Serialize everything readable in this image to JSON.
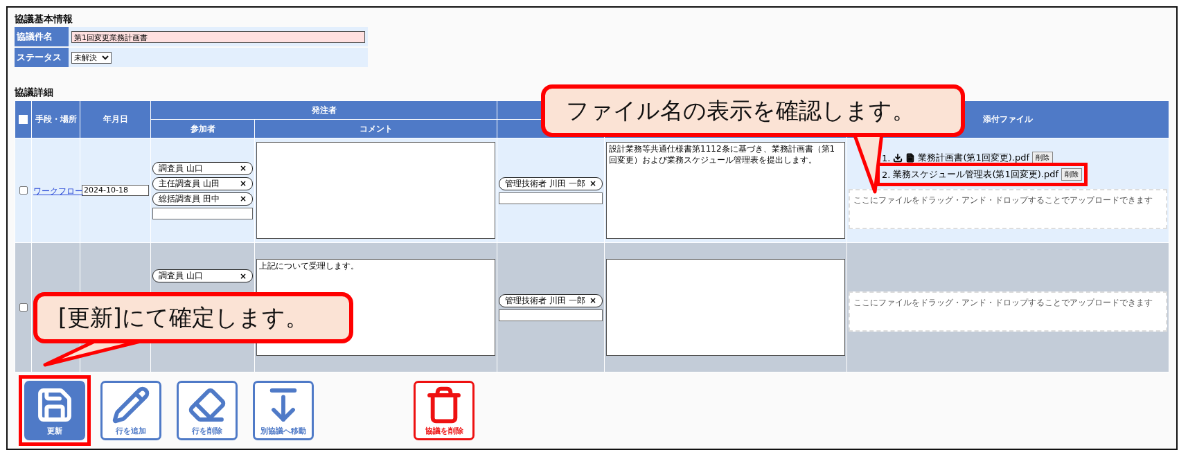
{
  "basic_info": {
    "title": "協議基本情報",
    "fields": [
      {
        "kind": "text",
        "label": "協議件名",
        "value": "第1回変更業務計画書"
      },
      {
        "kind": "select",
        "label": "ステータス",
        "value": "未解決"
      }
    ]
  },
  "details": {
    "title": "協議詳細",
    "header": {
      "select_all_checked": false,
      "columns": [
        "手段・場所",
        "年月日"
      ],
      "group": "発注者",
      "group_columns": [
        "参加者",
        "コメント"
      ],
      "attachments": "添付ファイル"
    },
    "rows": [
      {
        "checked": false,
        "method": "ワークフロー",
        "date": "2024-10-18",
        "orderer_participants": [
          {
            "name": "調査員 山口",
            "remove": "×"
          },
          {
            "name": "主任調査員 山田",
            "remove": "×"
          },
          {
            "name": "総括調査員 田中",
            "remove": "×"
          }
        ],
        "orderer_comment": "",
        "contractor_participants": [
          {
            "name": "管理技術者 川田 一郎",
            "remove": "×"
          }
        ],
        "contractor_comment": "設計業務等共通仕様書第1112条に基づき、業務計画書（第1回変更）および業務スケジュール管理表を提出します。",
        "files": [
          {
            "number": "1.",
            "name": "業務計画書(第1回変更).pdf",
            "delete": "削除",
            "highlighted": false
          },
          {
            "number": "2.",
            "name": "業務スケジュール管理表(第1回変更).pdf",
            "delete": "削除",
            "highlighted": true
          }
        ],
        "dropzone": "ここにファイルをドラッグ・アンド・ドロップすることでアップロードできます"
      },
      {
        "checked": false,
        "orderer_participants": [
          {
            "name": "調査員 山口",
            "remove": "×"
          }
        ],
        "orderer_comment": "上記について受理します。",
        "contractor_participants": [
          {
            "name": "管理技術者 川田 一郎",
            "remove": "×"
          }
        ],
        "contractor_comment": "",
        "files": [],
        "dropzone": "ここにファイルをドラッグ・アンド・ドロップすることでアップロードできます"
      }
    ]
  },
  "actions": [
    {
      "kind": "primary",
      "label": "更新",
      "highlighted": true
    },
    {
      "kind": "outline",
      "label": "行を追加",
      "highlighted": false
    },
    {
      "kind": "outline",
      "label": "行を削除",
      "highlighted": false
    },
    {
      "kind": "outline",
      "label": "別協議へ移動",
      "highlighted": false
    },
    {
      "kind": "danger",
      "label": "協議を削除",
      "highlighted": false
    }
  ],
  "callouts": [
    {
      "text": "ファイル名の表示を確認します。"
    },
    {
      "text": "[更新]にて確定します。"
    }
  ]
}
